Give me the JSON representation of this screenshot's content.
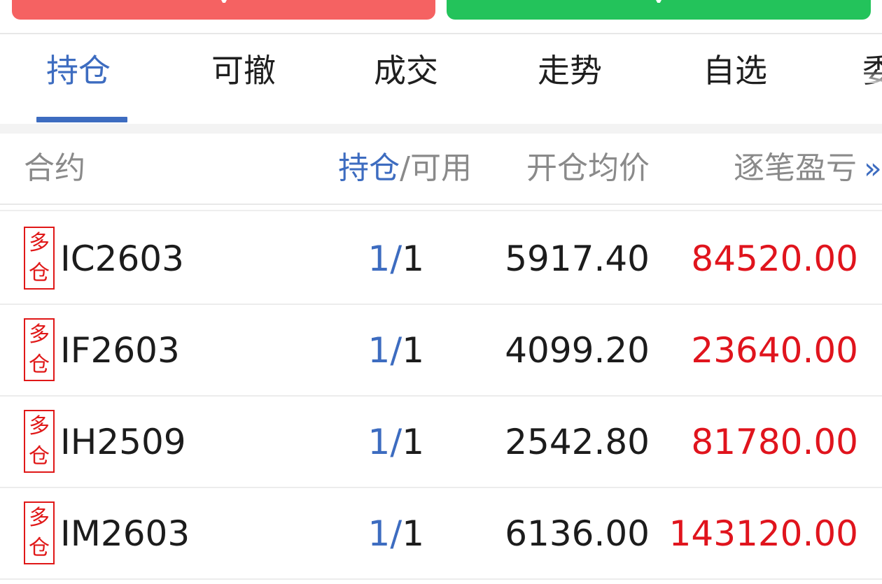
{
  "colors": {
    "accent": "#3d6cc0",
    "buy_button": "#f56262",
    "sell_button": "#23c35b",
    "profit_red": "#e0141d",
    "badge_red": "#e01818"
  },
  "tabs": [
    {
      "label": "持仓",
      "active": true
    },
    {
      "label": "可撤",
      "active": false
    },
    {
      "label": "成交",
      "active": false
    },
    {
      "label": "走势",
      "active": false
    },
    {
      "label": "自选",
      "active": false
    },
    {
      "label": "委",
      "active": false
    }
  ],
  "columns": {
    "contract": "合约",
    "position_held": "持仓",
    "position_sep_available": "/可用",
    "avg_open_price": "开仓均价",
    "pnl": "逐笔盈亏",
    "more_arrow": "»"
  },
  "positions": [
    {
      "direction_top": "多",
      "direction_bottom": "仓",
      "contract": "IC2603",
      "held": "1/",
      "available": "1",
      "avg_price": "5917.40",
      "pnl": "84520.00"
    },
    {
      "direction_top": "多",
      "direction_bottom": "仓",
      "contract": "IF2603",
      "held": "1/",
      "available": "1",
      "avg_price": "4099.20",
      "pnl": "23640.00"
    },
    {
      "direction_top": "多",
      "direction_bottom": "仓",
      "contract": "IH2509",
      "held": "1/",
      "available": "1",
      "avg_price": "2542.80",
      "pnl": "81780.00"
    },
    {
      "direction_top": "多",
      "direction_bottom": "仓",
      "contract": "IM2603",
      "held": "1/",
      "available": "1",
      "avg_price": "6136.00",
      "pnl": "143120.00"
    }
  ]
}
